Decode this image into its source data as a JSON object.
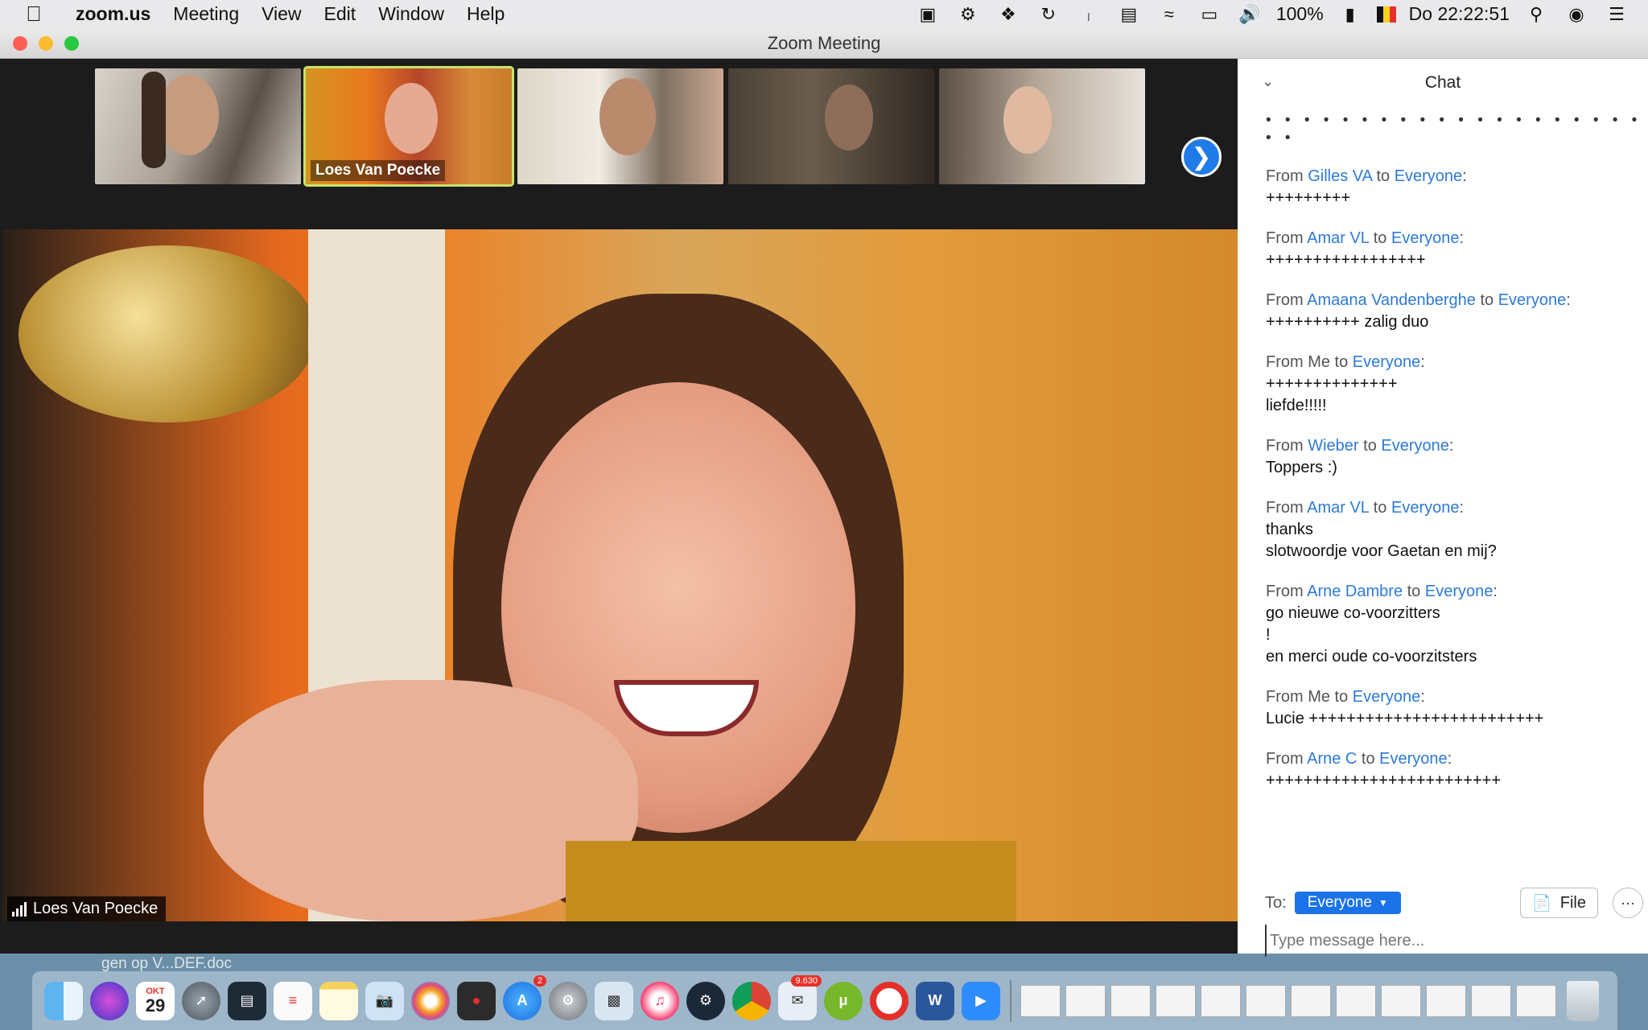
{
  "menubar": {
    "app_name": "zoom.us",
    "items": [
      "Meeting",
      "View",
      "Edit",
      "Window",
      "Help"
    ],
    "battery": "100%",
    "clock": "Do 22:22:51"
  },
  "window": {
    "title": "Zoom Meeting"
  },
  "video": {
    "active_thumbnail_name": "Loes Van Poecke",
    "main_speaker_name": "Loes Van Poecke"
  },
  "chat": {
    "title": "Chat",
    "dots": "• • • • • • • • • • • • • • • • • • • • • •",
    "messages": [
      {
        "prefix": "From ",
        "sender": "Gilles VA",
        "mid": " to ",
        "recipient": "Everyone",
        "suffix": ":",
        "lines": [
          "+++++++++"
        ]
      },
      {
        "prefix": "From ",
        "sender": "Amar VL",
        "mid": " to ",
        "recipient": "Everyone",
        "suffix": ":",
        "lines": [
          "+++++++++++++++++"
        ]
      },
      {
        "prefix": "From ",
        "sender": "Amaana Vandenberghe",
        "mid": " to ",
        "recipient": "Everyone",
        "suffix": ":",
        "lines": [
          "++++++++++ zalig duo"
        ]
      },
      {
        "prefix": "From Me",
        "sender": "",
        "mid": " to ",
        "recipient": "Everyone",
        "suffix": ":",
        "lines": [
          "++++++++++++++",
          "liefde!!!!!"
        ]
      },
      {
        "prefix": "From ",
        "sender": "Wieber",
        "mid": " to ",
        "recipient": "Everyone",
        "suffix": ":",
        "lines": [
          "Toppers :)"
        ]
      },
      {
        "prefix": "From ",
        "sender": "Amar VL",
        "mid": " to ",
        "recipient": "Everyone",
        "suffix": ":",
        "lines": [
          "thanks",
          "slotwoordje voor Gaetan en mij?"
        ]
      },
      {
        "prefix": "From ",
        "sender": "Arne Dambre",
        "mid": " to ",
        "recipient": "Everyone",
        "suffix": ":",
        "lines": [
          "go nieuwe co-voorzitters",
          "!",
          "en merci oude co-voorzitsters"
        ]
      },
      {
        "prefix": "From Me",
        "sender": "",
        "mid": " to ",
        "recipient": "Everyone",
        "suffix": ":",
        "lines": [
          "Lucie +++++++++++++++++++++++++"
        ]
      },
      {
        "prefix": "From ",
        "sender": "Arne C",
        "mid": " to ",
        "recipient": "Everyone",
        "suffix": ":",
        "lines": [
          "+++++++++++++++++++++++++"
        ]
      }
    ],
    "to_label": "To:",
    "to_value": "Everyone",
    "file_label": "File",
    "more_label": "···",
    "input_placeholder": "Type message here..."
  },
  "desktop": {
    "file_label": "gen op V...DEF.doc"
  },
  "dock": {
    "calendar_month": "OKT",
    "calendar_day": "29",
    "appstore_badge": "2",
    "mail_badge": "9.630"
  }
}
